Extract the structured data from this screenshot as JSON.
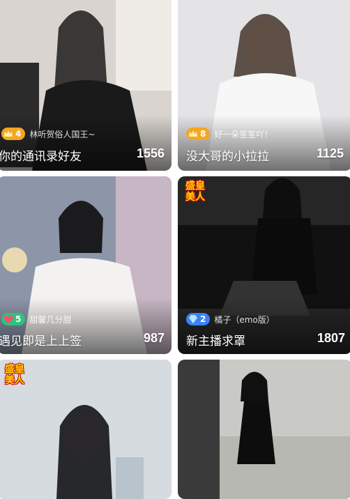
{
  "cards": [
    {
      "badge_level": "4",
      "anchor": "林听贺俗人国王~",
      "title": "你的通讯录好友",
      "viewers": "1556",
      "badge_type": "crown"
    },
    {
      "badge_level": "8",
      "anchor": "好一朵笙笙吖!",
      "title": "没大哥的小拉拉",
      "viewers": "1125",
      "badge_type": "crown"
    },
    {
      "badge_level": "5",
      "anchor": "甜馨几分甜",
      "title": "遇见即是上上签",
      "viewers": "987",
      "badge_type": "heart"
    },
    {
      "badge_level": "2",
      "anchor": "橘子（emo版）",
      "title": "新主播求罩",
      "viewers": "1807",
      "badge_type": "diamond",
      "tag": [
        "盛皇",
        "美人"
      ]
    },
    {
      "tag": [
        "盛皇",
        "美人"
      ]
    },
    {}
  ],
  "colors": {
    "crown_badge": "#f5a623",
    "heart_badge": "#2ec27e",
    "diamond_badge": "#3b82f6"
  }
}
